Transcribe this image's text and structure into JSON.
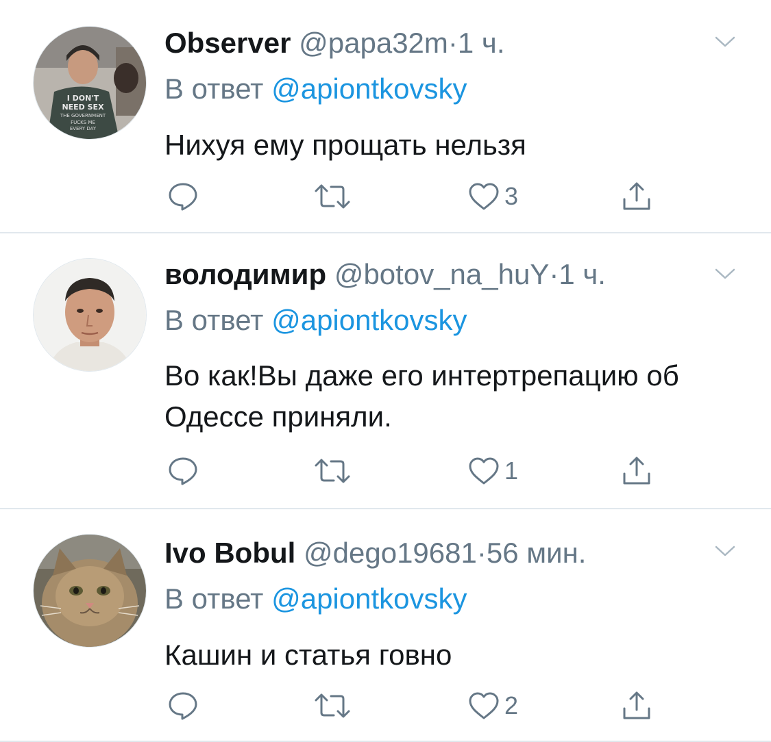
{
  "tweets": [
    {
      "name": "Observer",
      "handle": "@papa32m",
      "separator": "·",
      "time": "1 ч.",
      "reply_prefix": "В ответ",
      "reply_to": "@apiontkovsky",
      "text": "Нихуя ему прощать нельзя",
      "likes": "3",
      "avatar": "avatar-observer-tshirt",
      "avatar_shirt_text": "I DON'T NEED SEX THE GOVERNMENT FUCKS ME EVERY DAY"
    },
    {
      "name": "володимир",
      "handle": "@botov_na_huY",
      "separator": "·",
      "time": "1 ч.",
      "reply_prefix": "В ответ",
      "reply_to": "@apiontkovsky",
      "text": "Во как!Вы даже его интертрепацию об Одессе приняли.",
      "likes": "1",
      "avatar": "avatar-man-portrait"
    },
    {
      "name": "Ivo Bobul",
      "handle": "@dego19681",
      "separator": "·",
      "time": "56 мин.",
      "reply_prefix": "В ответ",
      "reply_to": "@apiontkovsky",
      "text": "Кашин и статья говно",
      "likes": "2",
      "avatar": "avatar-cat"
    }
  ],
  "icons": {
    "reply": "reply-icon",
    "retweet": "retweet-icon",
    "like": "heart-icon",
    "share": "share-icon",
    "more": "chevron-down-icon"
  },
  "colors": {
    "name": "#14171a",
    "secondary": "#657786",
    "link": "#1b95e0",
    "divider": "#e1e8ed"
  }
}
